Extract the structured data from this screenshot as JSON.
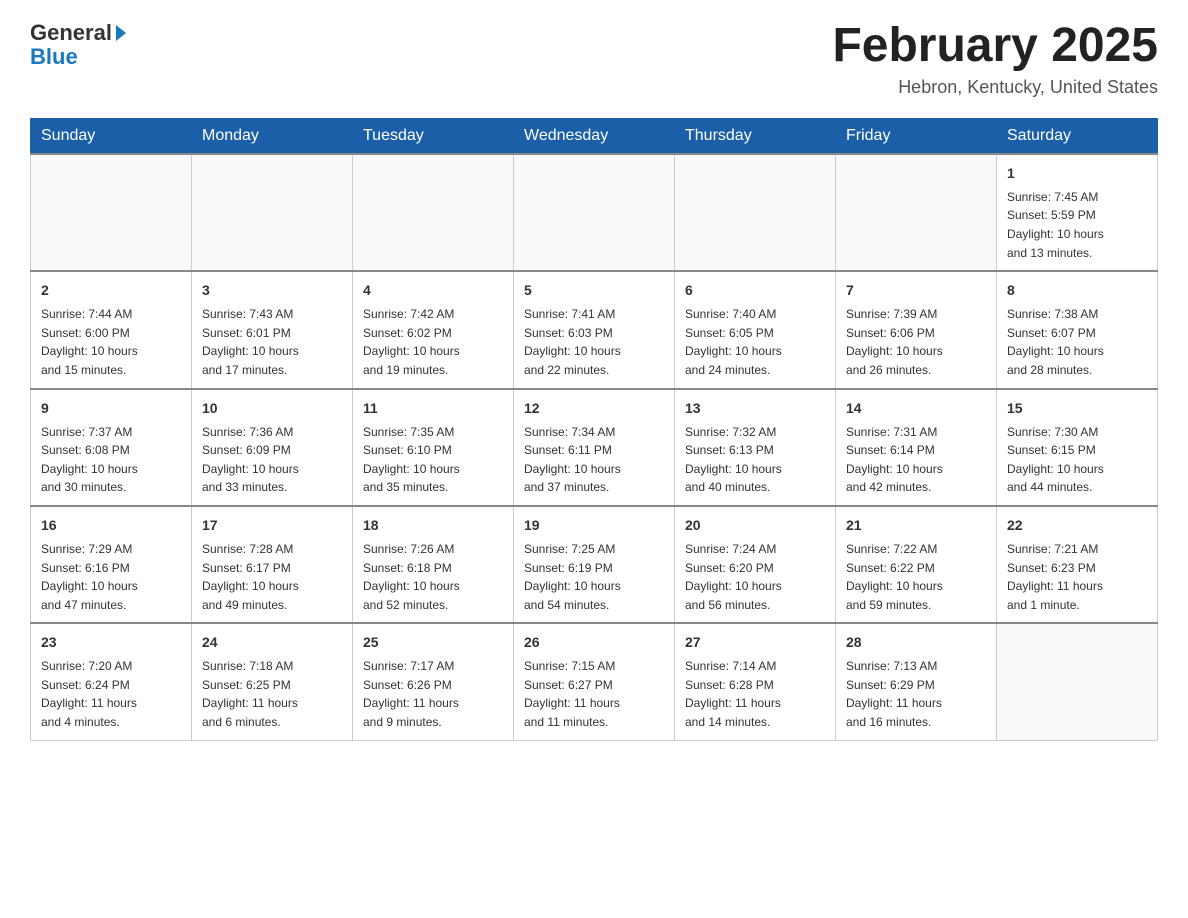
{
  "header": {
    "logo_general": "General",
    "logo_blue": "Blue",
    "month_title": "February 2025",
    "location": "Hebron, Kentucky, United States"
  },
  "days_of_week": [
    "Sunday",
    "Monday",
    "Tuesday",
    "Wednesday",
    "Thursday",
    "Friday",
    "Saturday"
  ],
  "weeks": [
    [
      {
        "day": "",
        "info": ""
      },
      {
        "day": "",
        "info": ""
      },
      {
        "day": "",
        "info": ""
      },
      {
        "day": "",
        "info": ""
      },
      {
        "day": "",
        "info": ""
      },
      {
        "day": "",
        "info": ""
      },
      {
        "day": "1",
        "info": "Sunrise: 7:45 AM\nSunset: 5:59 PM\nDaylight: 10 hours\nand 13 minutes."
      }
    ],
    [
      {
        "day": "2",
        "info": "Sunrise: 7:44 AM\nSunset: 6:00 PM\nDaylight: 10 hours\nand 15 minutes."
      },
      {
        "day": "3",
        "info": "Sunrise: 7:43 AM\nSunset: 6:01 PM\nDaylight: 10 hours\nand 17 minutes."
      },
      {
        "day": "4",
        "info": "Sunrise: 7:42 AM\nSunset: 6:02 PM\nDaylight: 10 hours\nand 19 minutes."
      },
      {
        "day": "5",
        "info": "Sunrise: 7:41 AM\nSunset: 6:03 PM\nDaylight: 10 hours\nand 22 minutes."
      },
      {
        "day": "6",
        "info": "Sunrise: 7:40 AM\nSunset: 6:05 PM\nDaylight: 10 hours\nand 24 minutes."
      },
      {
        "day": "7",
        "info": "Sunrise: 7:39 AM\nSunset: 6:06 PM\nDaylight: 10 hours\nand 26 minutes."
      },
      {
        "day": "8",
        "info": "Sunrise: 7:38 AM\nSunset: 6:07 PM\nDaylight: 10 hours\nand 28 minutes."
      }
    ],
    [
      {
        "day": "9",
        "info": "Sunrise: 7:37 AM\nSunset: 6:08 PM\nDaylight: 10 hours\nand 30 minutes."
      },
      {
        "day": "10",
        "info": "Sunrise: 7:36 AM\nSunset: 6:09 PM\nDaylight: 10 hours\nand 33 minutes."
      },
      {
        "day": "11",
        "info": "Sunrise: 7:35 AM\nSunset: 6:10 PM\nDaylight: 10 hours\nand 35 minutes."
      },
      {
        "day": "12",
        "info": "Sunrise: 7:34 AM\nSunset: 6:11 PM\nDaylight: 10 hours\nand 37 minutes."
      },
      {
        "day": "13",
        "info": "Sunrise: 7:32 AM\nSunset: 6:13 PM\nDaylight: 10 hours\nand 40 minutes."
      },
      {
        "day": "14",
        "info": "Sunrise: 7:31 AM\nSunset: 6:14 PM\nDaylight: 10 hours\nand 42 minutes."
      },
      {
        "day": "15",
        "info": "Sunrise: 7:30 AM\nSunset: 6:15 PM\nDaylight: 10 hours\nand 44 minutes."
      }
    ],
    [
      {
        "day": "16",
        "info": "Sunrise: 7:29 AM\nSunset: 6:16 PM\nDaylight: 10 hours\nand 47 minutes."
      },
      {
        "day": "17",
        "info": "Sunrise: 7:28 AM\nSunset: 6:17 PM\nDaylight: 10 hours\nand 49 minutes."
      },
      {
        "day": "18",
        "info": "Sunrise: 7:26 AM\nSunset: 6:18 PM\nDaylight: 10 hours\nand 52 minutes."
      },
      {
        "day": "19",
        "info": "Sunrise: 7:25 AM\nSunset: 6:19 PM\nDaylight: 10 hours\nand 54 minutes."
      },
      {
        "day": "20",
        "info": "Sunrise: 7:24 AM\nSunset: 6:20 PM\nDaylight: 10 hours\nand 56 minutes."
      },
      {
        "day": "21",
        "info": "Sunrise: 7:22 AM\nSunset: 6:22 PM\nDaylight: 10 hours\nand 59 minutes."
      },
      {
        "day": "22",
        "info": "Sunrise: 7:21 AM\nSunset: 6:23 PM\nDaylight: 11 hours\nand 1 minute."
      }
    ],
    [
      {
        "day": "23",
        "info": "Sunrise: 7:20 AM\nSunset: 6:24 PM\nDaylight: 11 hours\nand 4 minutes."
      },
      {
        "day": "24",
        "info": "Sunrise: 7:18 AM\nSunset: 6:25 PM\nDaylight: 11 hours\nand 6 minutes."
      },
      {
        "day": "25",
        "info": "Sunrise: 7:17 AM\nSunset: 6:26 PM\nDaylight: 11 hours\nand 9 minutes."
      },
      {
        "day": "26",
        "info": "Sunrise: 7:15 AM\nSunset: 6:27 PM\nDaylight: 11 hours\nand 11 minutes."
      },
      {
        "day": "27",
        "info": "Sunrise: 7:14 AM\nSunset: 6:28 PM\nDaylight: 11 hours\nand 14 minutes."
      },
      {
        "day": "28",
        "info": "Sunrise: 7:13 AM\nSunset: 6:29 PM\nDaylight: 11 hours\nand 16 minutes."
      },
      {
        "day": "",
        "info": ""
      }
    ]
  ]
}
